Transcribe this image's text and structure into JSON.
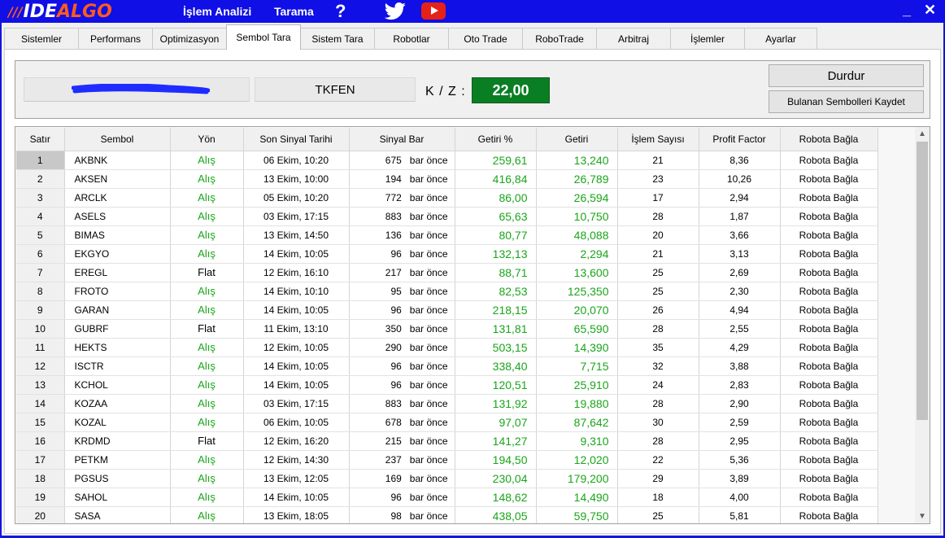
{
  "app": {
    "logo_bars": "///",
    "logo_ide": "IDE",
    "logo_algo": "ALGO",
    "menu": [
      "İşlem Analizi",
      "Tarama"
    ],
    "help": "?",
    "minimize": "_",
    "close": "✕"
  },
  "tabs": [
    "Sistemler",
    "Performans",
    "Optimizasyon",
    "Sembol Tara",
    "Sistem Tara",
    "Robotlar",
    "Oto Trade",
    "RoboTrade",
    "Arbitraj",
    "İşlemler",
    "Ayarlar"
  ],
  "active_tab": "Sembol Tara",
  "control": {
    "symbol": "TKFEN",
    "kz_label": "K / Z :",
    "kz_value": "22,00",
    "stop_button": "Durdur",
    "save_button": "Bulanan Sembolleri Kaydet"
  },
  "grid": {
    "columns": [
      "Satır",
      "Sembol",
      "Yön",
      "Son Sinyal Tarihi",
      "Sinyal Bar",
      "Getiri %",
      "Getiri",
      "İşlem Sayısı",
      "Profit Factor",
      "Robota Bağla"
    ],
    "bar_suffix": "bar önce",
    "rows": [
      [
        "1",
        "AKBNK",
        "Alış",
        "06 Ekim,  10:20",
        "675",
        "259,61",
        "13,240",
        "21",
        "8,36",
        "Robota Bağla"
      ],
      [
        "2",
        "AKSEN",
        "Alış",
        "13 Ekim,  10:00",
        "194",
        "416,84",
        "26,789",
        "23",
        "10,26",
        "Robota Bağla"
      ],
      [
        "3",
        "ARCLK",
        "Alış",
        "05 Ekim,  10:20",
        "772",
        "86,00",
        "26,594",
        "17",
        "2,94",
        "Robota Bağla"
      ],
      [
        "4",
        "ASELS",
        "Alış",
        "03 Ekim,  17:15",
        "883",
        "65,63",
        "10,750",
        "28",
        "1,87",
        "Robota Bağla"
      ],
      [
        "5",
        "BIMAS",
        "Alış",
        "13 Ekim,  14:50",
        "136",
        "80,77",
        "48,088",
        "20",
        "3,66",
        "Robota Bağla"
      ],
      [
        "6",
        "EKGYO",
        "Alış",
        "14 Ekim,  10:05",
        "96",
        "132,13",
        "2,294",
        "21",
        "3,13",
        "Robota Bağla"
      ],
      [
        "7",
        "EREGL",
        "Flat",
        "12 Ekim,  16:10",
        "217",
        "88,71",
        "13,600",
        "25",
        "2,69",
        "Robota Bağla"
      ],
      [
        "8",
        "FROTO",
        "Alış",
        "14 Ekim,  10:10",
        "95",
        "82,53",
        "125,350",
        "25",
        "2,30",
        "Robota Bağla"
      ],
      [
        "9",
        "GARAN",
        "Alış",
        "14 Ekim,  10:05",
        "96",
        "218,15",
        "20,070",
        "26",
        "4,94",
        "Robota Bağla"
      ],
      [
        "10",
        "GUBRF",
        "Flat",
        "11 Ekim,  13:10",
        "350",
        "131,81",
        "65,590",
        "28",
        "2,55",
        "Robota Bağla"
      ],
      [
        "11",
        "HEKTS",
        "Alış",
        "12 Ekim,  10:05",
        "290",
        "503,15",
        "14,390",
        "35",
        "4,29",
        "Robota Bağla"
      ],
      [
        "12",
        "ISCTR",
        "Alış",
        "14 Ekim,  10:05",
        "96",
        "338,40",
        "7,715",
        "32",
        "3,88",
        "Robota Bağla"
      ],
      [
        "13",
        "KCHOL",
        "Alış",
        "14 Ekim,  10:05",
        "96",
        "120,51",
        "25,910",
        "24",
        "2,83",
        "Robota Bağla"
      ],
      [
        "14",
        "KOZAA",
        "Alış",
        "03 Ekim,  17:15",
        "883",
        "131,92",
        "19,880",
        "28",
        "2,90",
        "Robota Bağla"
      ],
      [
        "15",
        "KOZAL",
        "Alış",
        "06 Ekim,  10:05",
        "678",
        "97,07",
        "87,642",
        "30",
        "2,59",
        "Robota Bağla"
      ],
      [
        "16",
        "KRDMD",
        "Flat",
        "12 Ekim,  16:20",
        "215",
        "141,27",
        "9,310",
        "28",
        "2,95",
        "Robota Bağla"
      ],
      [
        "17",
        "PETKM",
        "Alış",
        "12 Ekim,  14:30",
        "237",
        "194,50",
        "12,020",
        "22",
        "5,36",
        "Robota Bağla"
      ],
      [
        "18",
        "PGSUS",
        "Alış",
        "13 Ekim,  12:05",
        "169",
        "230,04",
        "179,200",
        "29",
        "3,89",
        "Robota Bağla"
      ],
      [
        "19",
        "SAHOL",
        "Alış",
        "14 Ekim,  10:05",
        "96",
        "148,62",
        "14,490",
        "18",
        "4,00",
        "Robota Bağla"
      ],
      [
        "20",
        "SASA",
        "Alış",
        "13 Ekim,  18:05",
        "98",
        "438,05",
        "59,750",
        "25",
        "5,81",
        "Robota Bağla"
      ]
    ]
  },
  "colors": {
    "titlebar": "#0f0fe6",
    "logo_accent": "#ff5a1f",
    "kz_bg": "#0a7e23",
    "positive_text": "#1aa51a"
  }
}
